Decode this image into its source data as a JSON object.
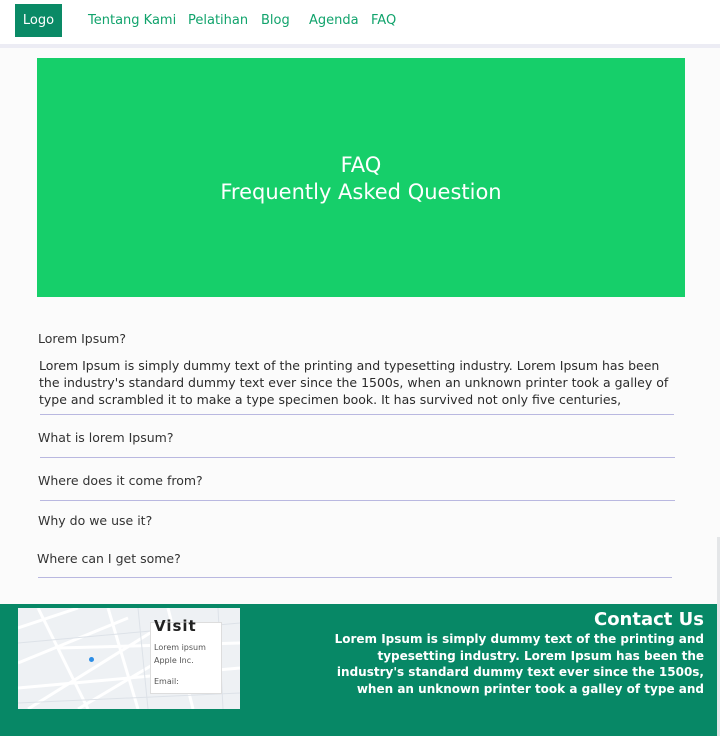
{
  "nav": {
    "logo": "Logo",
    "items": [
      "Tentang Kami",
      "Pelatihan",
      "Blog",
      "Agenda",
      "FAQ"
    ]
  },
  "hero": {
    "title": "FAQ",
    "subtitle": "Frequently Asked Question"
  },
  "faq": {
    "items": [
      {
        "question": "Lorem Ipsum?",
        "answer": "Lorem Ipsum is simply dummy text of the printing and typesetting industry. Lorem Ipsum has been the industry's standard dummy text ever since the 1500s, when an unknown printer took a galley of type and scrambled it to make a type specimen book. It has survived not only five centuries,"
      },
      {
        "question": "What is lorem Ipsum?"
      },
      {
        "question": "Where does it come from?"
      },
      {
        "question": "Why do we use it?"
      },
      {
        "question": "Where can I get some?"
      }
    ]
  },
  "footer": {
    "map": {
      "card_title": "Visit",
      "lines": [
        "Lorem ipsum",
        "Apple Inc.",
        "Email:"
      ]
    },
    "contact_title": "Contact Us",
    "contact_text": "Lorem Ipsum is simply dummy text of the printing and typesetting industry. Lorem Ipsum has been the industry's standard dummy text ever since the 1500s, when an unknown printer took a galley of type and"
  },
  "colors": {
    "brand_dark": "#0a8a66",
    "hero_green": "#16cf6a",
    "nav_link": "#11a36c",
    "footer_bg": "#078866"
  }
}
